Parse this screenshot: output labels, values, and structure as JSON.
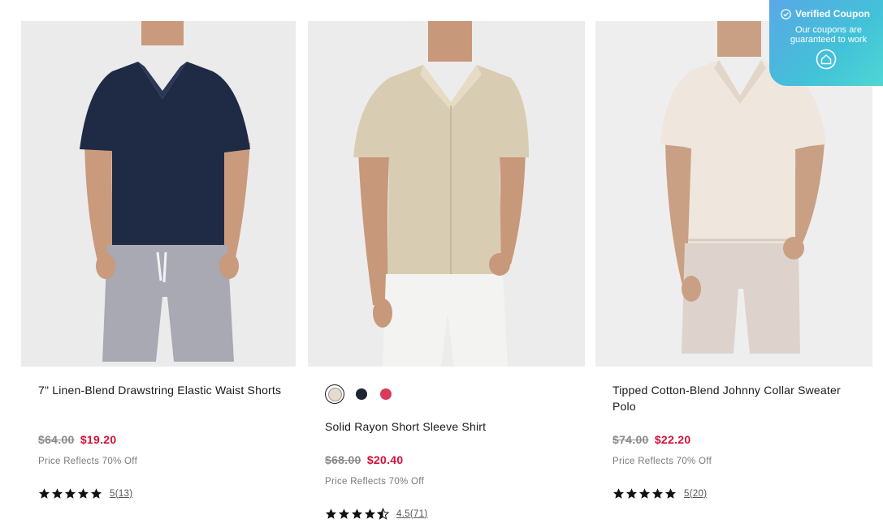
{
  "coupon": {
    "title": "Verified Coupon",
    "line1": "Our coupons are",
    "line2": "guaranteed to work",
    "icon": "home-badge-icon"
  },
  "products": [
    {
      "title": "7\" Linen-Blend Drawstring Elastic Waist Shorts",
      "old_price": "$64.00",
      "new_price": "$19.20",
      "note": "Price Reflects 70% Off",
      "rating": 5,
      "rating_label": "5(13)"
    },
    {
      "title": "Solid Rayon Short Sleeve Shirt",
      "old_price": "$68.00",
      "new_price": "$20.40",
      "note": "Price Reflects 70% Off",
      "rating": 4.5,
      "rating_label": "4.5(71)",
      "swatches": [
        "#e3dccb",
        "#1d2433",
        "#d93a5e"
      ]
    },
    {
      "title": "Tipped Cotton-Blend Johnny Collar Sweater Polo",
      "old_price": "$74.00",
      "new_price": "$22.20",
      "note": "Price Reflects 70% Off",
      "rating": 5,
      "rating_label": "5(20)"
    }
  ],
  "colors": {
    "sale": "#d40f3a",
    "old_price": "#8a8a8a",
    "coupon_start": "#5aa7e6",
    "coupon_end": "#4fd6d3"
  }
}
